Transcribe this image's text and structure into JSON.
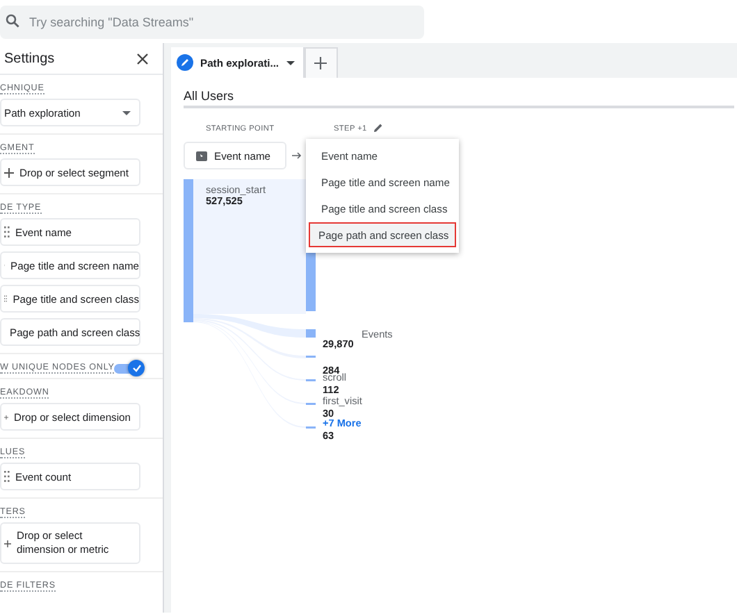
{
  "search": {
    "placeholder": "Try searching \"Data Streams\""
  },
  "settings": {
    "title": "Settings",
    "sections": [
      {
        "label": "CHNIQUE",
        "kind": "select",
        "value": "Path exploration"
      },
      {
        "label": "GMENT",
        "kind": "add",
        "items": [
          "Drop or select segment"
        ]
      },
      {
        "label": "DE TYPE",
        "kind": "list",
        "items": [
          "Event name",
          "Page title and screen name",
          "Page title and screen class",
          "Page path and screen class"
        ]
      },
      {
        "label": "W UNIQUE NODES ONLY",
        "kind": "toggle",
        "on": true
      },
      {
        "label": "EAKDOWN",
        "kind": "add",
        "items": [
          "Drop or select dimension"
        ]
      },
      {
        "label": "LUES",
        "kind": "list",
        "items": [
          "Event count"
        ]
      },
      {
        "label": "TERS",
        "kind": "add",
        "items": [
          "Drop or select dimension or metric"
        ]
      },
      {
        "label": "DE FILTERS",
        "kind": "label"
      }
    ]
  },
  "tabs": [
    {
      "label": "Path explorati...",
      "selected": true
    }
  ],
  "segment": "All Users",
  "starting_point": {
    "heading": "STARTING POINT",
    "node_type": "Event name",
    "node": {
      "name": "session_start",
      "value": "527,525"
    }
  },
  "step": {
    "heading": "STEP +1",
    "menu": [
      {
        "label": "Event name",
        "selected": false
      },
      {
        "label": "Page title and screen name",
        "selected": false
      },
      {
        "label": "Page title and screen class",
        "selected": false
      },
      {
        "label": "Page path and screen class",
        "selected": true
      }
    ],
    "nodes": [
      {
        "name": "Events",
        "value": "29,870"
      },
      {
        "value": "284"
      },
      {
        "name": "scroll",
        "value": "112"
      },
      {
        "name": "first_visit",
        "value": "30"
      },
      {
        "name": "+7 More",
        "kind": "more",
        "value": "63"
      }
    ]
  }
}
